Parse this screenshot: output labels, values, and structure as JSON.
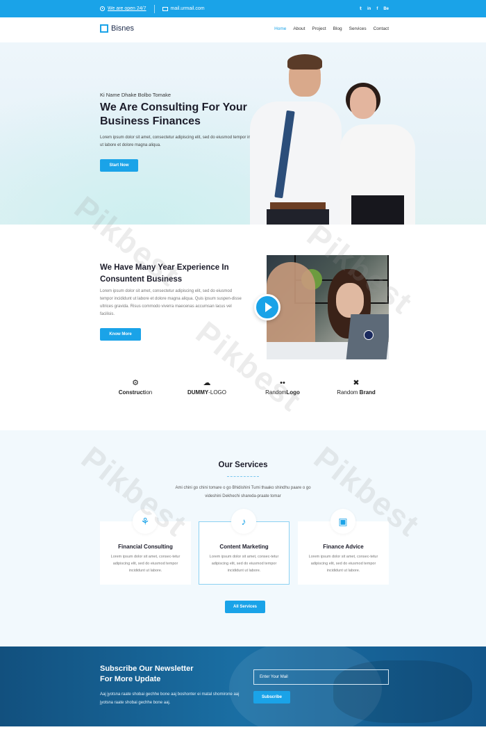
{
  "topbar": {
    "open_text": "We are open 24/7",
    "email": "mail.urmail.com",
    "social": [
      "twitter-icon",
      "linkedin-icon",
      "facebook-icon",
      "behance-icon"
    ],
    "social_labels": [
      "𝕥",
      "in",
      "f",
      "Be"
    ]
  },
  "navbar": {
    "logo_text": "Bisnes",
    "links": [
      "Home",
      "About",
      "Project",
      "Blog",
      "Services",
      "Contact"
    ],
    "active": "Home"
  },
  "hero": {
    "kicker": "Ki Name Dhake  Bolbo Tomake",
    "title": "We Are Consulting For Your Business Finances",
    "description": "Lorem ipsum dolor sit amet, consectetur adipiscing elit, sed do eiusmod tempor incididunt ut labore et dolore magna aliqua.",
    "button": "Start Now"
  },
  "experience": {
    "title": "We Have Many Year Experience In Consuntent Business",
    "description": "Lorem ipsum dolor sit amet, consectetur adipiscing elit, sed do eiusmod tempor incididunt ut labore et dolore magna aliqua. Quis ipsum suspen-disse ultrices gravida. Risus commodo viverra maecenas accumsan lacus vel facilisis.",
    "button": "Know More"
  },
  "brands": [
    {
      "icon": "gears-icon",
      "glyph": "⚙",
      "label_bold": "Construct",
      "label_rest": "ion"
    },
    {
      "icon": "cloud-icon",
      "glyph": "☁",
      "label_bold": "DUMMY",
      "label_rest": "-LOGO"
    },
    {
      "icon": "glasses-icon",
      "glyph": "••",
      "label_bold": "Logo",
      "label_rest": "Random"
    },
    {
      "icon": "tools-icon",
      "glyph": "✖",
      "label_bold": "Brand",
      "label_rest": "Random "
    }
  ],
  "services": {
    "title": "Our Services",
    "description": "Ami chini go chini tomare o go Bhidishini Tumi thaako shindhu paare o go videshini Dekhechi shareda-praate tomar",
    "cards": [
      {
        "icon": "hand-money-icon",
        "glyph": "⚘",
        "title": "Financial Consulting",
        "desc": "Lorem ipsum dolor sit amet, consec-tetur adipiscing elit, sed do eiusmod tempor incididunt ut labore."
      },
      {
        "icon": "megaphone-icon",
        "glyph": "♪",
        "title": "Content Marketing",
        "desc": "Lorem ipsum dolor sit amet, consec-tetur adipiscing elit, sed do eiusmod tempor incididunt ut labore."
      },
      {
        "icon": "money-icon",
        "glyph": "▣",
        "title": "Finance Advice",
        "desc": "Lorem ipsum dolor sit amet, consec-tetur adipiscing elit, sed do eiusmod tempor incididunt ut labore."
      }
    ],
    "button": "All Services"
  },
  "newsletter": {
    "title_line1": "Subscribe Our Newsletter",
    "title_line2": "For More Update",
    "description": "Aaj jyotsna raate shobai gechhe bone aaj boshonter ei matal shomirone aaj jyotsna raate shobai gechhe bone aaj.",
    "input_placeholder": "Enter Your Mail",
    "button": "Subscribe"
  },
  "watermark": "Pikbest",
  "colors": {
    "accent": "#1aa3e8",
    "dark": "#1c1c2a",
    "newsletter_bg": "#1a6fa4"
  }
}
